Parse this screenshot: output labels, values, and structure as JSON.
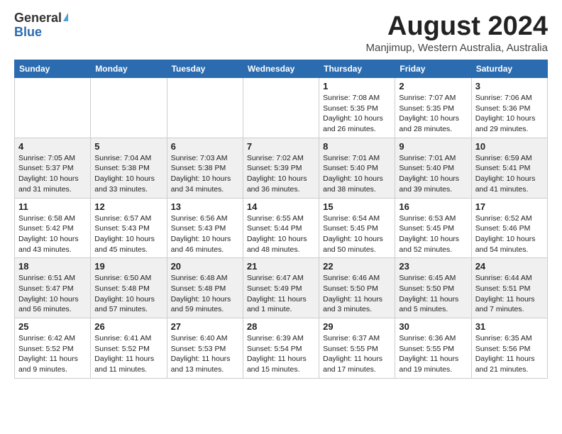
{
  "logo": {
    "general": "General",
    "blue": "Blue"
  },
  "title": "August 2024",
  "subtitle": "Manjimup, Western Australia, Australia",
  "headers": [
    "Sunday",
    "Monday",
    "Tuesday",
    "Wednesday",
    "Thursday",
    "Friday",
    "Saturday"
  ],
  "weeks": [
    [
      {
        "day": "",
        "info": ""
      },
      {
        "day": "",
        "info": ""
      },
      {
        "day": "",
        "info": ""
      },
      {
        "day": "",
        "info": ""
      },
      {
        "day": "1",
        "info": "Sunrise: 7:08 AM\nSunset: 5:35 PM\nDaylight: 10 hours\nand 26 minutes."
      },
      {
        "day": "2",
        "info": "Sunrise: 7:07 AM\nSunset: 5:35 PM\nDaylight: 10 hours\nand 28 minutes."
      },
      {
        "day": "3",
        "info": "Sunrise: 7:06 AM\nSunset: 5:36 PM\nDaylight: 10 hours\nand 29 minutes."
      }
    ],
    [
      {
        "day": "4",
        "info": "Sunrise: 7:05 AM\nSunset: 5:37 PM\nDaylight: 10 hours\nand 31 minutes."
      },
      {
        "day": "5",
        "info": "Sunrise: 7:04 AM\nSunset: 5:38 PM\nDaylight: 10 hours\nand 33 minutes."
      },
      {
        "day": "6",
        "info": "Sunrise: 7:03 AM\nSunset: 5:38 PM\nDaylight: 10 hours\nand 34 minutes."
      },
      {
        "day": "7",
        "info": "Sunrise: 7:02 AM\nSunset: 5:39 PM\nDaylight: 10 hours\nand 36 minutes."
      },
      {
        "day": "8",
        "info": "Sunrise: 7:01 AM\nSunset: 5:40 PM\nDaylight: 10 hours\nand 38 minutes."
      },
      {
        "day": "9",
        "info": "Sunrise: 7:01 AM\nSunset: 5:40 PM\nDaylight: 10 hours\nand 39 minutes."
      },
      {
        "day": "10",
        "info": "Sunrise: 6:59 AM\nSunset: 5:41 PM\nDaylight: 10 hours\nand 41 minutes."
      }
    ],
    [
      {
        "day": "11",
        "info": "Sunrise: 6:58 AM\nSunset: 5:42 PM\nDaylight: 10 hours\nand 43 minutes."
      },
      {
        "day": "12",
        "info": "Sunrise: 6:57 AM\nSunset: 5:43 PM\nDaylight: 10 hours\nand 45 minutes."
      },
      {
        "day": "13",
        "info": "Sunrise: 6:56 AM\nSunset: 5:43 PM\nDaylight: 10 hours\nand 46 minutes."
      },
      {
        "day": "14",
        "info": "Sunrise: 6:55 AM\nSunset: 5:44 PM\nDaylight: 10 hours\nand 48 minutes."
      },
      {
        "day": "15",
        "info": "Sunrise: 6:54 AM\nSunset: 5:45 PM\nDaylight: 10 hours\nand 50 minutes."
      },
      {
        "day": "16",
        "info": "Sunrise: 6:53 AM\nSunset: 5:45 PM\nDaylight: 10 hours\nand 52 minutes."
      },
      {
        "day": "17",
        "info": "Sunrise: 6:52 AM\nSunset: 5:46 PM\nDaylight: 10 hours\nand 54 minutes."
      }
    ],
    [
      {
        "day": "18",
        "info": "Sunrise: 6:51 AM\nSunset: 5:47 PM\nDaylight: 10 hours\nand 56 minutes."
      },
      {
        "day": "19",
        "info": "Sunrise: 6:50 AM\nSunset: 5:48 PM\nDaylight: 10 hours\nand 57 minutes."
      },
      {
        "day": "20",
        "info": "Sunrise: 6:48 AM\nSunset: 5:48 PM\nDaylight: 10 hours\nand 59 minutes."
      },
      {
        "day": "21",
        "info": "Sunrise: 6:47 AM\nSunset: 5:49 PM\nDaylight: 11 hours\nand 1 minute."
      },
      {
        "day": "22",
        "info": "Sunrise: 6:46 AM\nSunset: 5:50 PM\nDaylight: 11 hours\nand 3 minutes."
      },
      {
        "day": "23",
        "info": "Sunrise: 6:45 AM\nSunset: 5:50 PM\nDaylight: 11 hours\nand 5 minutes."
      },
      {
        "day": "24",
        "info": "Sunrise: 6:44 AM\nSunset: 5:51 PM\nDaylight: 11 hours\nand 7 minutes."
      }
    ],
    [
      {
        "day": "25",
        "info": "Sunrise: 6:42 AM\nSunset: 5:52 PM\nDaylight: 11 hours\nand 9 minutes."
      },
      {
        "day": "26",
        "info": "Sunrise: 6:41 AM\nSunset: 5:52 PM\nDaylight: 11 hours\nand 11 minutes."
      },
      {
        "day": "27",
        "info": "Sunrise: 6:40 AM\nSunset: 5:53 PM\nDaylight: 11 hours\nand 13 minutes."
      },
      {
        "day": "28",
        "info": "Sunrise: 6:39 AM\nSunset: 5:54 PM\nDaylight: 11 hours\nand 15 minutes."
      },
      {
        "day": "29",
        "info": "Sunrise: 6:37 AM\nSunset: 5:55 PM\nDaylight: 11 hours\nand 17 minutes."
      },
      {
        "day": "30",
        "info": "Sunrise: 6:36 AM\nSunset: 5:55 PM\nDaylight: 11 hours\nand 19 minutes."
      },
      {
        "day": "31",
        "info": "Sunrise: 6:35 AM\nSunset: 5:56 PM\nDaylight: 11 hours\nand 21 minutes."
      }
    ]
  ]
}
